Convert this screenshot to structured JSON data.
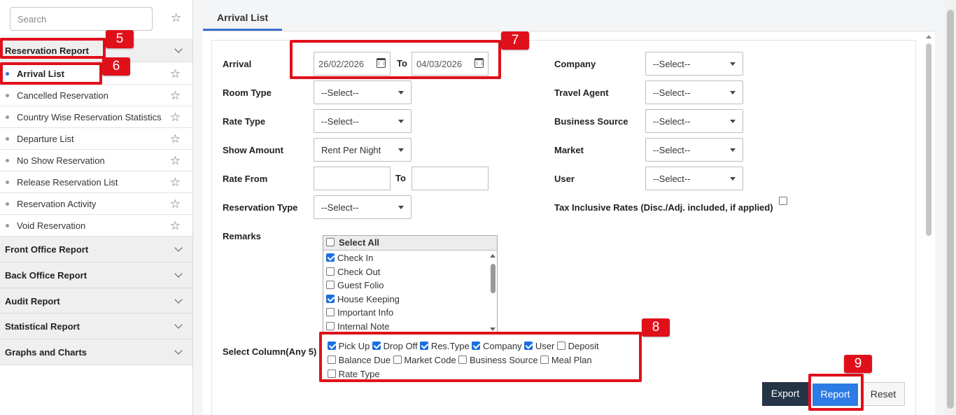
{
  "sidebar": {
    "search": {
      "placeholder": "Search"
    },
    "reservation_section": "Reservation Report",
    "items": [
      {
        "label": "Arrival List",
        "active": true
      },
      {
        "label": "Cancelled Reservation"
      },
      {
        "label": "Country Wise Reservation Statistics"
      },
      {
        "label": "Departure List"
      },
      {
        "label": "No Show Reservation"
      },
      {
        "label": "Release Reservation List"
      },
      {
        "label": "Reservation Activity"
      },
      {
        "label": "Void Reservation"
      }
    ],
    "sections": [
      "Front Office Report",
      "Back Office Report",
      "Audit Report",
      "Statistical Report",
      "Graphs and Charts"
    ]
  },
  "tabs": {
    "active": "Arrival List"
  },
  "form": {
    "arrival": {
      "label": "Arrival",
      "from": "26/02/2026",
      "to_label": "To",
      "to": "04/03/2026"
    },
    "room_type": {
      "label": "Room Type",
      "value": "--Select--"
    },
    "rate_type": {
      "label": "Rate Type",
      "value": "--Select--"
    },
    "show_amount": {
      "label": "Show Amount",
      "value": "Rent Per Night"
    },
    "rate_from": {
      "label": "Rate From",
      "from": "",
      "to_label": "To",
      "to": ""
    },
    "reservation_type": {
      "label": "Reservation Type",
      "value": "--Select--"
    },
    "company": {
      "label": "Company",
      "value": "--Select--"
    },
    "travel_agent": {
      "label": "Travel Agent",
      "value": "--Select--"
    },
    "business_source": {
      "label": "Business Source",
      "value": "--Select--"
    },
    "market": {
      "label": "Market",
      "value": "--Select--"
    },
    "user": {
      "label": "User",
      "value": "--Select--"
    },
    "tax_inclusive": {
      "label": "Tax Inclusive Rates (Disc./Adj. included, if applied)",
      "checked": false
    },
    "remarks": {
      "label": "Remarks",
      "select_all": "Select All",
      "items": [
        {
          "label": "Check In",
          "checked": true
        },
        {
          "label": "Check Out",
          "checked": false
        },
        {
          "label": "Guest Folio",
          "checked": false
        },
        {
          "label": "House Keeping",
          "checked": true
        },
        {
          "label": "Important Info",
          "checked": false
        },
        {
          "label": "Internal Note",
          "checked": false
        }
      ]
    },
    "select_column": {
      "label": "Select Column(Any 5)",
      "options": [
        {
          "label": "Pick Up",
          "checked": true
        },
        {
          "label": "Drop Off",
          "checked": true
        },
        {
          "label": "Res.Type",
          "checked": true
        },
        {
          "label": "Company",
          "checked": true
        },
        {
          "label": "User",
          "checked": true
        },
        {
          "label": "Deposit",
          "checked": false
        },
        {
          "label": "Balance Due",
          "checked": false
        },
        {
          "label": "Market Code",
          "checked": false
        },
        {
          "label": "Business Source",
          "checked": false
        },
        {
          "label": "Meal Plan",
          "checked": false
        },
        {
          "label": "Rate Type",
          "checked": false
        }
      ]
    }
  },
  "buttons": {
    "export": "Export",
    "report": "Report",
    "reset": "Reset"
  },
  "annotations": [
    "5",
    "6",
    "7",
    "8",
    "9"
  ],
  "colors": {
    "accent": "#2d7be5",
    "annotation": "#e0101b",
    "dark_button": "#253446"
  }
}
